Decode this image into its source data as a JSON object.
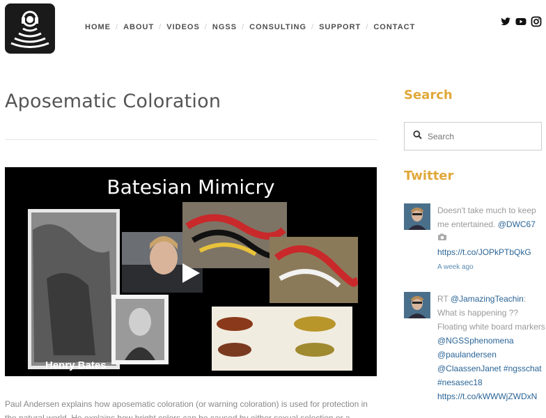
{
  "nav": {
    "items": [
      "HOME",
      "ABOUT",
      "VIDEOS",
      "NGSS",
      "CONSULTING",
      "SUPPORT",
      "CONTACT"
    ]
  },
  "social": [
    "twitter-icon",
    "youtube-icon",
    "instagram-icon"
  ],
  "post": {
    "title": "Aposematic Coloration",
    "video_title": "Batesian Mimicry",
    "video_caption": "Henry Bates",
    "description": "Paul Andersen explains how aposematic coloration (or warning coloration) is used for protection in the natural world. He explains how bright colors can be caused by either sexual selection or a"
  },
  "sidebar": {
    "search_heading": "Search",
    "search_placeholder": "Search",
    "twitter_heading": "Twitter",
    "tweet1": {
      "text": "Doesn't take much to keep me entertained. ",
      "mention": "@DWC67",
      "link": "https://t.co/JOPkPTbQkG",
      "time": "A week ago"
    },
    "tweet2": {
      "prefix": "RT ",
      "mention1": "@JamazingTeachin",
      "text1": ": What is happening ?? Floating white board markers",
      "mention2": "@NGSSphenomena",
      "mention3": "@paulandersen",
      "mention4": "@ClaassenJanet",
      "tag1": "#ngsschat",
      "tag2": "#nesasec18",
      "link": "https://t.co/kWWWjZWDxN"
    }
  },
  "colors": {
    "accent": "#e0a83a",
    "link": "#2a6496"
  }
}
